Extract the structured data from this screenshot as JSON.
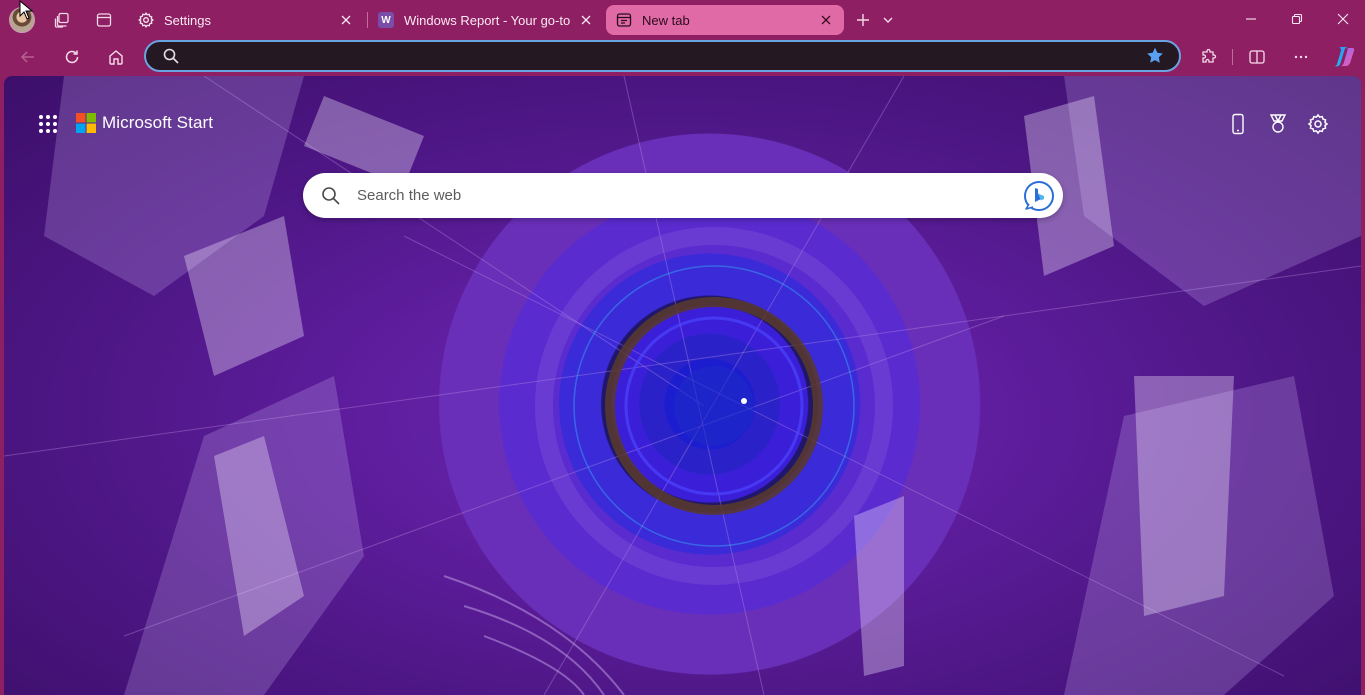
{
  "browser": {
    "tabs": [
      {
        "title": "Settings",
        "icon": "gear-icon",
        "active": false
      },
      {
        "title": "Windows Report - Your go-to source",
        "icon": "windows-report-icon",
        "favicon_letter": "W",
        "active": false
      },
      {
        "title": "New tab",
        "icon": "new-tab-icon",
        "active": true
      }
    ],
    "address_bar": {
      "value": "",
      "placeholder": ""
    },
    "accent": "#8e1f63",
    "active_tab_color": "#e06aa6"
  },
  "page": {
    "brand": "Microsoft Start",
    "search": {
      "placeholder": "Search the web"
    }
  }
}
